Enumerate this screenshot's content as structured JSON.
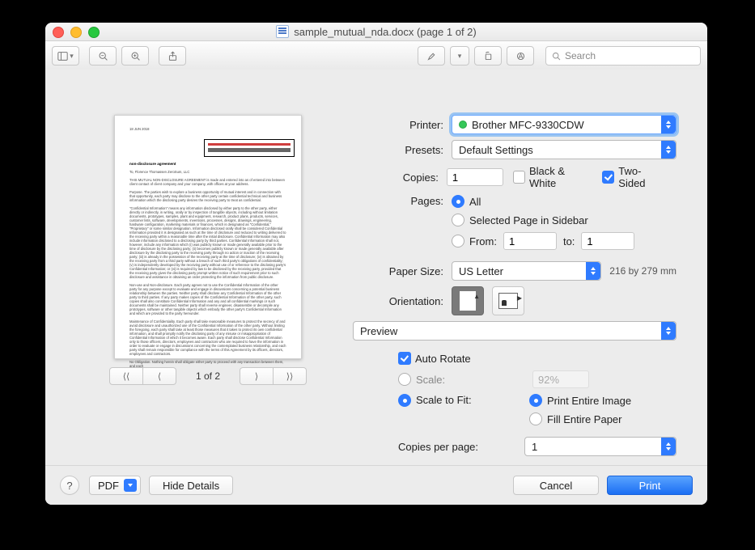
{
  "titlebar": {
    "title": "sample_mutual_nda.docx (page 1 of 2)"
  },
  "toolbar": {
    "search_placeholder": "Search"
  },
  "preview": {
    "page_indicator": "1 of 2",
    "doc": {
      "date": "18 JUN 2018",
      "heading": "non-disclosure agreement",
      "to_block": "To,\nFlorence Thomassen\nZeroSum, LLC",
      "intro": "THIS MUTUAL NON-DISCLOSURE AGREEMENT is made and entered into as of entered into between client contact of client company and your company, with offices at your address.",
      "p1": "Purpose. The parties wish to explore a business opportunity of mutual interest and in connection with that opportunity, each party may disclose to the other party certain confidential technical and business information which the disclosing party desires the receiving party to treat as confidential.",
      "p2": "\"Confidential Information\" means any information disclosed by either party to the other party, either directly or indirectly, in writing, orally or by inspection of tangible objects, including without limitation documents, prototypes, samples, plant and equipment, research, product plans, products, services, customer lists, software, developments, inventions, processes, designs, drawings, engineering, hardware configuration, marketing materials or finances, which is designated as \"Confidential,\" \"Proprietary\" or some similar designation. Information disclosed orally shall be considered Confidential Information provided it is designated as such at the time of disclosure and reduced to writing delivered to the receiving party within a reasonable time after the initial disclosure. Confidential Information may also include information disclosed to a disclosing party by third parties. Confidential Information shall not, however, include any information which (i) was publicly known or made generally available prior to the time of disclosure by the disclosing party; (ii) becomes publicly known or made generally available after disclosure by the disclosing party to the receiving party through no action or inaction of the receiving party; (iii) is already in the possession of the receiving party at the time of disclosure; (iv) is obtained by the receiving party from a third party without a breach of such third party's obligations of confidentiality; (v) is independently developed by the receiving party without use of or reference to the disclosing party's Confidential Information; or (vi) is required by law to be disclosed by the receiving party, provided that the receiving party gives the disclosing party prompt written notice of such requirement prior to such disclosure and assistance in obtaining an order protecting the information from public disclosure.",
      "p3": "Non-use and Non-disclosure. Each party agrees not to use the Confidential Information of the other party for any purpose except to evaluate and engage in discussions concerning a potential business relationship between the parties. Neither party shall disclose any Confidential Information of the other party to third parties. If any party makes copies of the Confidential Information of the other party, such copies shall also constitute Confidential Information and any and all confidential markings or such documents shall be maintained. Neither party shall reverse engineer, disassemble or decompile any prototypes, software or other tangible objects which embody the other party's Confidential Information and which are provided to the party hereunder.",
      "p4": "Maintenance of Confidentiality. Each party shall take reasonable measures to protect the secrecy of and avoid disclosure and unauthorized use of the Confidential Information of the other party. Without limiting the foregoing, each party shall take at least those measures that it takes to protect its own confidential information, and shall promptly notify the disclosing party of any misuse or misappropriation of Confidential Information of which it becomes aware. Each party shall disclose Confidential Information only to those officers, directors, employees and contractors who are required to have the information in order to evaluate or engage in discussions concerning the contemplated business relationship, and each party shall remain responsible for compliance with the terms of this Agreement by its officers, directors, employees and contractors.",
      "p5": "No Obligation. Nothing herein shall obligate either party to proceed with any transaction between them, and each"
    }
  },
  "form": {
    "printer": {
      "label": "Printer:",
      "value": "Brother MFC-9330CDW"
    },
    "presets": {
      "label": "Presets:",
      "value": "Default Settings"
    },
    "copies": {
      "label": "Copies:",
      "value": "1",
      "bw_label": "Black & White",
      "two_sided_label": "Two-Sided"
    },
    "pages": {
      "label": "Pages:",
      "all": "All",
      "selected": "Selected Page in Sidebar",
      "from_label": "From:",
      "from_value": "1",
      "to_label": "to:",
      "to_value": "1"
    },
    "paper": {
      "label": "Paper Size:",
      "value": "US Letter",
      "dimensions": "216 by 279 mm"
    },
    "orientation": {
      "label": "Orientation:"
    },
    "panel": {
      "value": "Preview"
    },
    "auto_rotate": "Auto Rotate",
    "scale": {
      "label": "Scale:",
      "value": "92%"
    },
    "scale_to_fit": {
      "label": "Scale to Fit:",
      "opt1": "Print Entire Image",
      "opt2": "Fill Entire Paper"
    },
    "copies_per_page": {
      "label": "Copies per page:",
      "value": "1"
    }
  },
  "bottom": {
    "pdf": "PDF",
    "hide_details": "Hide Details",
    "cancel": "Cancel",
    "print": "Print"
  }
}
